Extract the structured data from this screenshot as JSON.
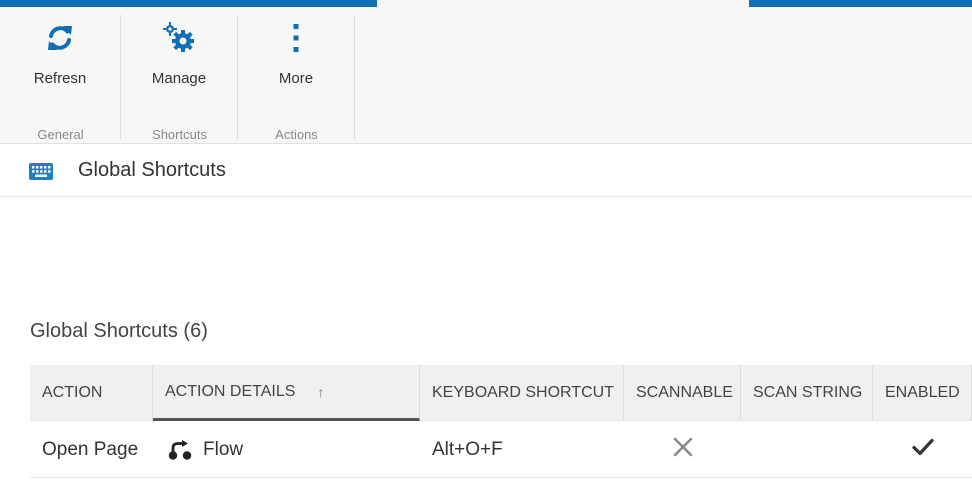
{
  "toolbar": {
    "groups": [
      {
        "label": "General",
        "buttons": [
          {
            "label": "Refresn",
            "icon": "refresh-icon"
          }
        ]
      },
      {
        "label": "Shortcuts",
        "buttons": [
          {
            "label": "Manage",
            "icon": "manage-gears-icon"
          }
        ]
      },
      {
        "label": "Actions",
        "buttons": [
          {
            "label": "More",
            "icon": "more-vertical-icon"
          }
        ]
      }
    ],
    "accent_color": "#0f6fb4"
  },
  "page_header": {
    "icon": "keyboard-icon",
    "title": "Global Shortcuts"
  },
  "section": {
    "title": "Global Shortcuts (6)"
  },
  "grid": {
    "columns": [
      "ACTION",
      "ACTION DETAILS",
      "KEYBOARD SHORTCUT",
      "SCANNABLE",
      "SCAN STRING",
      "ENABLED"
    ],
    "sort_indicator": "↑",
    "rows": [
      {
        "action": "Open Page",
        "details_icon": "flow-icon",
        "details": "Flow",
        "shortcut": "Alt+O+F",
        "scannable_icon": "cross-icon",
        "scan_string": "",
        "enabled_icon": "check-icon"
      }
    ]
  }
}
